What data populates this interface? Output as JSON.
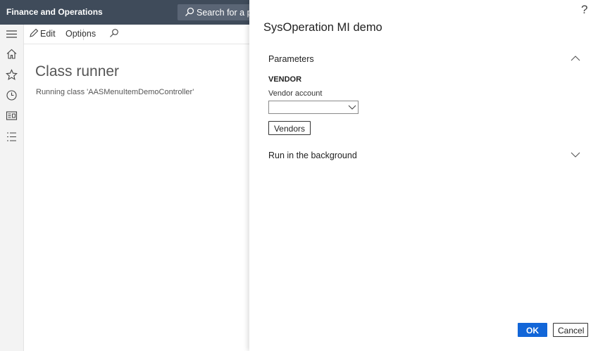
{
  "app": {
    "title": "Finance and Operations"
  },
  "search": {
    "text": "Search for a page"
  },
  "nav": {
    "items": [
      "menu-icon",
      "home-icon",
      "star-icon",
      "clock-icon",
      "workspace-icon",
      "list-icon"
    ]
  },
  "actionpane": {
    "edit_label": "Edit",
    "options_label": "Options"
  },
  "page": {
    "title": "Class runner",
    "subtitle": "Running class 'AASMenuItemDemoController'"
  },
  "dialog": {
    "help": "?",
    "title": "SysOperation MI demo",
    "parameters_label": "Parameters",
    "group_label": "VENDOR",
    "field_label": "Vendor account",
    "field_value": "",
    "vendors_button": "Vendors",
    "background_label": "Run in the background",
    "ok_label": "OK",
    "cancel_label": "Cancel"
  },
  "colors": {
    "topbar": "#3f4b5a",
    "primary_button": "#1266d8"
  }
}
